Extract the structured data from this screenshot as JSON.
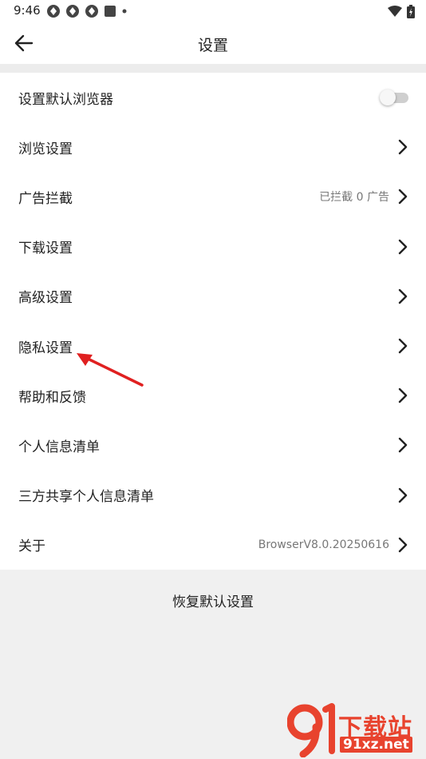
{
  "status_bar": {
    "time": "9:46"
  },
  "header": {
    "title": "设置"
  },
  "settings": {
    "default_browser": {
      "label": "设置默认浏览器",
      "enabled": false
    },
    "items": [
      {
        "label": "浏览设置",
        "value": ""
      },
      {
        "label": "广告拦截",
        "value": "已拦截 0 广告"
      },
      {
        "label": "下载设置",
        "value": ""
      },
      {
        "label": "高级设置",
        "value": ""
      },
      {
        "label": "隐私设置",
        "value": ""
      },
      {
        "label": "帮助和反馈",
        "value": ""
      },
      {
        "label": "个人信息清单",
        "value": ""
      },
      {
        "label": "三方共享个人信息清单",
        "value": ""
      },
      {
        "label": "关于",
        "value": "BrowserV8.0.20250616"
      }
    ]
  },
  "footer": {
    "restore_label": "恢复默认设置"
  },
  "watermark": {
    "text": "下载站",
    "url": "91xz.net"
  },
  "colors": {
    "accent_red": "#e8432e",
    "annotation_arrow": "#e02020"
  }
}
